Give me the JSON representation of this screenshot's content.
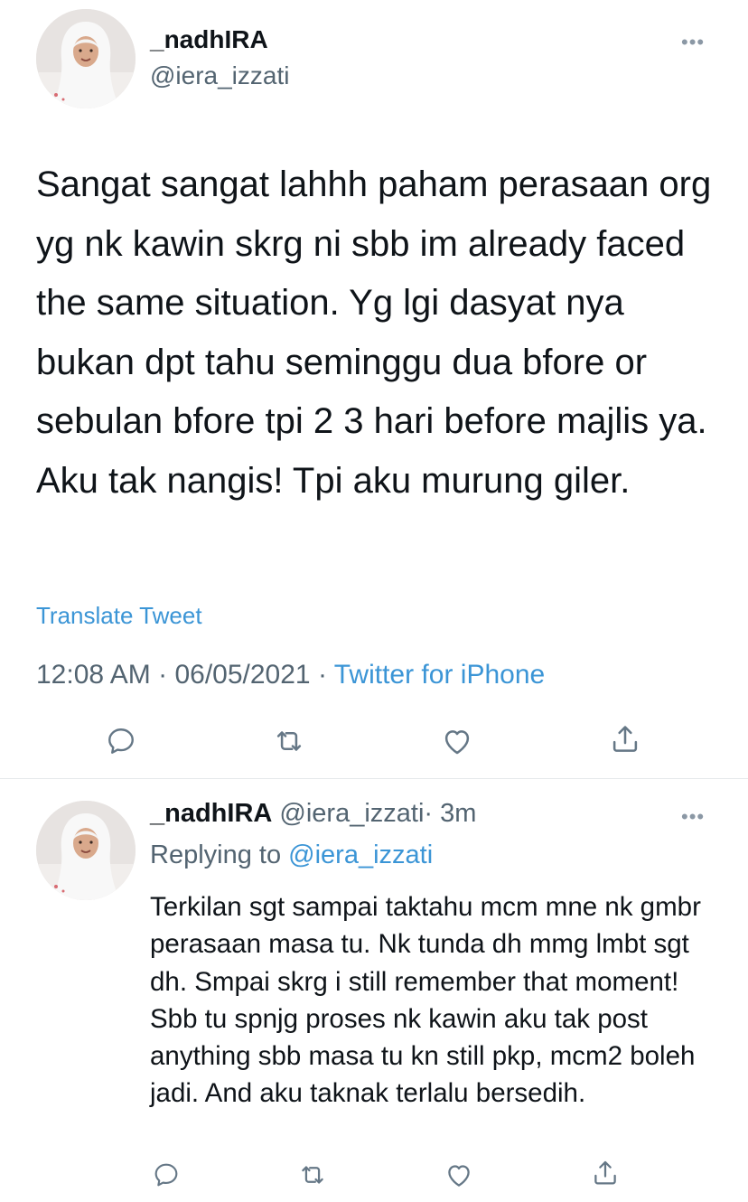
{
  "main_tweet": {
    "display_name": "_nadhIRA",
    "handle": "@iera_izzati",
    "more_label": "•••",
    "text": "Sangat sangat lahhh paham perasaan org yg nk kawin skrg ni sbb im already faced the same situation. Yg lgi dasyat nya bukan dpt tahu seminggu dua bfore or sebulan bfore tpi 2 3 hari before majlis ya. Aku tak nangis! Tpi aku murung giler.",
    "translate_label": "Translate Tweet",
    "time": "12:08 AM",
    "date": "06/05/2021",
    "separator": "·",
    "source": "Twitter for iPhone",
    "actions": [
      "reply-icon",
      "retweet-icon",
      "like-icon",
      "share-icon"
    ]
  },
  "reply_tweet": {
    "display_name": "_nadhIRA",
    "handle": "@iera_izzati",
    "separator": "·",
    "age": "3m",
    "more_label": "•••",
    "replying_prefix": "Replying to",
    "replying_to": "@iera_izzati",
    "text": "Terkilan sgt sampai taktahu mcm mne nk gmbr perasaan masa tu. Nk tunda dh mmg lmbt sgt dh. Smpai skrg i still remember that moment! Sbb tu spnjg proses nk kawin aku tak post anything sbb masa tu kn still pkp, mcm2 boleh jadi. And aku taknak terlalu bersedih.",
    "actions": [
      "reply-icon",
      "retweet-icon",
      "like-icon",
      "share-icon"
    ]
  },
  "colors": {
    "text": "#0f1419",
    "secondary": "#536471",
    "link": "#3b95d6",
    "icon": "#657786",
    "divider": "#e6e9eb"
  }
}
